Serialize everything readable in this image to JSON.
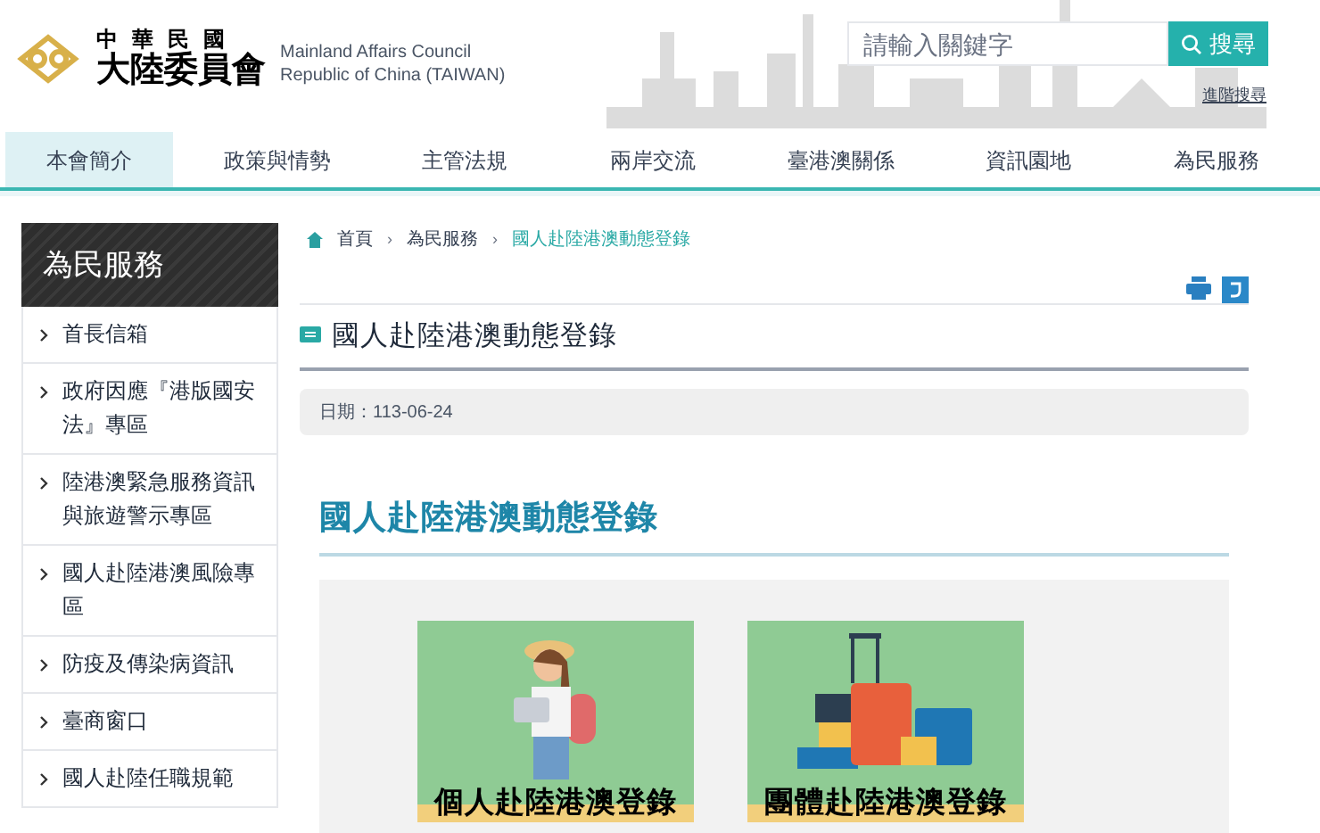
{
  "header": {
    "logo_text_top": "中華民國",
    "logo_text_bottom": "大陸委員會",
    "english_line_1": "Mainland Affairs Council",
    "english_line_2": "Republic of China (TAIWAN)",
    "search": {
      "placeholder": "請輸入關鍵字",
      "button": "搜尋"
    },
    "advanced_search": "進階搜尋"
  },
  "nav": [
    {
      "label": "本會簡介",
      "selected": true
    },
    {
      "label": "政策與情勢",
      "selected": false
    },
    {
      "label": "主管法規",
      "selected": false
    },
    {
      "label": "兩岸交流",
      "selected": false
    },
    {
      "label": "臺港澳關係",
      "selected": false
    },
    {
      "label": "資訊園地",
      "selected": false
    },
    {
      "label": "為民服務",
      "selected": false
    }
  ],
  "sidebar": {
    "title": "為民服務",
    "items": [
      "首長信箱",
      "政府因應『港版國安法』專區",
      "陸港澳緊急服務資訊與旅遊警示專區",
      "國人赴陸港澳風險專區",
      "防疫及傳染病資訊",
      "臺商窗口",
      "國人赴陸任職規範"
    ]
  },
  "breadcrumb_separator": "›",
  "breadcrumb": [
    {
      "label": "首頁",
      "current": false
    },
    {
      "label": "為民服務",
      "current": false
    },
    {
      "label": "國人赴陸港澳動態登錄",
      "current": true
    }
  ],
  "article": {
    "title": "國人赴陸港澳動態登錄",
    "date": "日期：113-06-24",
    "heading": "國人赴陸港澳動態登錄",
    "cards": [
      {
        "kind": "individual",
        "label": "個人赴陸港澳登錄"
      },
      {
        "kind": "group",
        "label": "團體赴陸港澳登錄"
      }
    ]
  }
}
